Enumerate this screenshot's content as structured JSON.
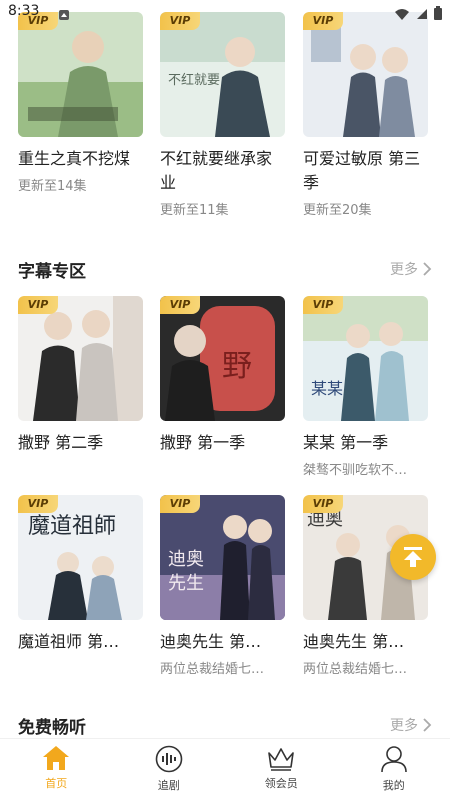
{
  "status_bar": {
    "time": "8:33"
  },
  "row1": [
    {
      "badge": "VIP",
      "title": "重生之真不挖煤",
      "subtitle": "更新至14集",
      "palette": [
        "#cfe1c7",
        "#7a9a6a",
        "#3f4d33"
      ]
    },
    {
      "badge": "VIP",
      "title": "不红就要继承家业",
      "subtitle": "更新至11集",
      "palette": [
        "#e6efe9",
        "#a7c2b2",
        "#3a4a55"
      ]
    },
    {
      "badge": "VIP",
      "title": "可爱过敏原 第三季",
      "subtitle": "更新至20集",
      "palette": [
        "#e9edf2",
        "#b7c3d1",
        "#4a5566"
      ]
    }
  ],
  "section_subtitles": {
    "title": "字幕专区",
    "more": "更多"
  },
  "row2": [
    {
      "badge": "VIP",
      "title": "撒野 第二季",
      "subtitle": "",
      "palette": [
        "#f1f0ee",
        "#c9c4bf",
        "#2b2b2b"
      ]
    },
    {
      "badge": "VIP",
      "title": "撒野 第一季",
      "subtitle": "",
      "palette": [
        "#c8504b",
        "#7a1f1d",
        "#1e1e1e"
      ]
    },
    {
      "badge": "VIP",
      "title": "某某 第一季",
      "subtitle": "桀骜不驯吃软不…",
      "palette": [
        "#e4eef1",
        "#9fc1cf",
        "#3c5a6a"
      ]
    }
  ],
  "row3": [
    {
      "badge": "VIP",
      "title": "魔道祖师 第…",
      "subtitle": "",
      "palette": [
        "#eef1f4",
        "#8ea3b8",
        "#27303a"
      ]
    },
    {
      "badge": "VIP",
      "title": "迪奥先生 第…",
      "subtitle": "两位总裁结婚七…",
      "palette": [
        "#4a4b6f",
        "#8c7ea8",
        "#f1e9ef"
      ]
    },
    {
      "badge": "VIP",
      "title": "迪奥先生 第…",
      "subtitle": "两位总裁结婚七…",
      "palette": [
        "#ece8e3",
        "#bfb6aa",
        "#3a3a3a"
      ]
    }
  ],
  "section_free": {
    "title": "免费畅听",
    "more": "更多"
  },
  "tabbar": {
    "items": [
      {
        "label": "首页",
        "icon": "home-icon",
        "active": true
      },
      {
        "label": "追剧",
        "icon": "audio-wave-icon",
        "active": false
      },
      {
        "label": "领会员",
        "icon": "crown-icon",
        "active": false
      },
      {
        "label": "我的",
        "icon": "user-icon",
        "active": false
      }
    ]
  },
  "colors": {
    "accent": "#f2a81d",
    "vip": "#f2c24b",
    "fab": "#f2b92a"
  }
}
